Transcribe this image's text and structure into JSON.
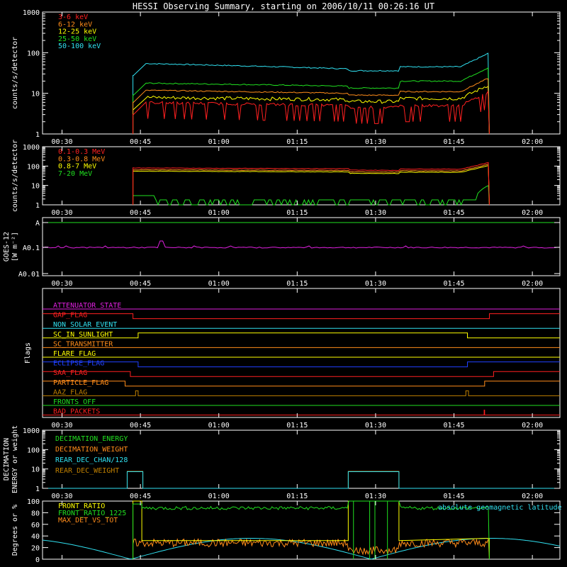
{
  "title": "HESSI Observing Summary, starting on 2006/10/11 00:26:16 UT",
  "time_ticks": [
    "00:30",
    "00:45",
    "01:00",
    "01:15",
    "01:30",
    "01:45",
    "02:00"
  ],
  "chart_data": [
    {
      "type": "line",
      "title": "",
      "ylabel": "counts/s/detector",
      "yscale": "log",
      "ylim": [
        1,
        1000
      ],
      "y_ticks": [
        "1",
        "10",
        "100",
        "1000"
      ],
      "xlim_minutes_from_00:26:16": [
        0,
        99
      ],
      "series": [
        {
          "name": "3-6 keV",
          "color": "#ff2020",
          "level": 5
        },
        {
          "name": "6-12 keV",
          "color": "#ff8c1a",
          "level": 10
        },
        {
          "name": "12-25 keV",
          "color": "#ffff00",
          "level": 7
        },
        {
          "name": "25-50 keV",
          "color": "#20e020",
          "level": 16
        },
        {
          "name": "50-100 keV",
          "color": "#30e0f0",
          "level": 40
        }
      ]
    },
    {
      "type": "line",
      "ylabel": "counts/s/detector",
      "yscale": "log",
      "ylim": [
        1,
        1000
      ],
      "y_ticks": [
        "1",
        "10",
        "100",
        "1000"
      ],
      "series": [
        {
          "name": "0.1-0.3 MeV",
          "color": "#ff2020",
          "level": 80
        },
        {
          "name": "0.3-0.8 MeV",
          "color": "#ff8c1a",
          "level": 65
        },
        {
          "name": "0.8-7 MeV",
          "color": "#ffff00",
          "level": 55
        },
        {
          "name": "7-20 MeV",
          "color": "#20e020",
          "level": 2
        }
      ]
    },
    {
      "type": "line",
      "ylabel": "GOES-12",
      "ylabel2": "[W m⁻²]",
      "yscale": "log",
      "y_ticks": [
        "A",
        "A0.1",
        "A0.01"
      ],
      "series": [
        {
          "name": "",
          "color": "#e020e0"
        }
      ]
    },
    {
      "type": "line",
      "ylabel": "Flags",
      "series": [
        {
          "name": "ATTENUATOR_STATE",
          "color": "#e020e0"
        },
        {
          "name": "GAP_FLAG",
          "color": "#ff2020"
        },
        {
          "name": "NON_SOLAR_EVENT",
          "color": "#30e0f0"
        },
        {
          "name": "SC_IN_SUNLIGHT",
          "color": "#ffff00"
        },
        {
          "name": "SC_TRANSMITTER",
          "color": "#ff8c1a"
        },
        {
          "name": "FLARE_FLAG",
          "color": "#ffff00"
        },
        {
          "name": "ECLIPSE_FLAG",
          "color": "#2040ff"
        },
        {
          "name": "SAA_FLAG",
          "color": "#ff2020"
        },
        {
          "name": "PARTICLE_FLAG",
          "color": "#ff8c1a"
        },
        {
          "name": "AAZ_FLAG",
          "color": "#c08000"
        },
        {
          "name": "FRONTS_OFF",
          "color": "#20e020"
        },
        {
          "name": "BAD_PACKETS",
          "color": "#ff2020"
        }
      ]
    },
    {
      "type": "line",
      "ylabel": "DECIMATION",
      "ylabel2": "ENERGY or weight",
      "yscale": "log",
      "y_ticks": [
        "1",
        "10",
        "100",
        "1000"
      ],
      "series": [
        {
          "name": "DECIMATION_ENERGY",
          "color": "#20e020"
        },
        {
          "name": "DECIMATION_WEIGHT",
          "color": "#ff8c1a"
        },
        {
          "name": "REAR_DEC_CHAN/128",
          "color": "#30e0f0"
        },
        {
          "name": "REAR_DEC_WEIGHT",
          "color": "#c08000"
        }
      ]
    },
    {
      "type": "line",
      "ylabel": "Degrees or %",
      "ylim": [
        0,
        100
      ],
      "y_ticks": [
        "0",
        "20",
        "40",
        "60",
        "80",
        "100"
      ],
      "annotation": "absolute geomagnetic latitude",
      "series": [
        {
          "name": "FRONT_RATIO",
          "color": "#ffff00"
        },
        {
          "name": "FRONT_RATIO_1225",
          "color": "#20e020"
        },
        {
          "name": "MAX_DET_VS_TOT",
          "color": "#ff8c1a"
        }
      ]
    }
  ]
}
